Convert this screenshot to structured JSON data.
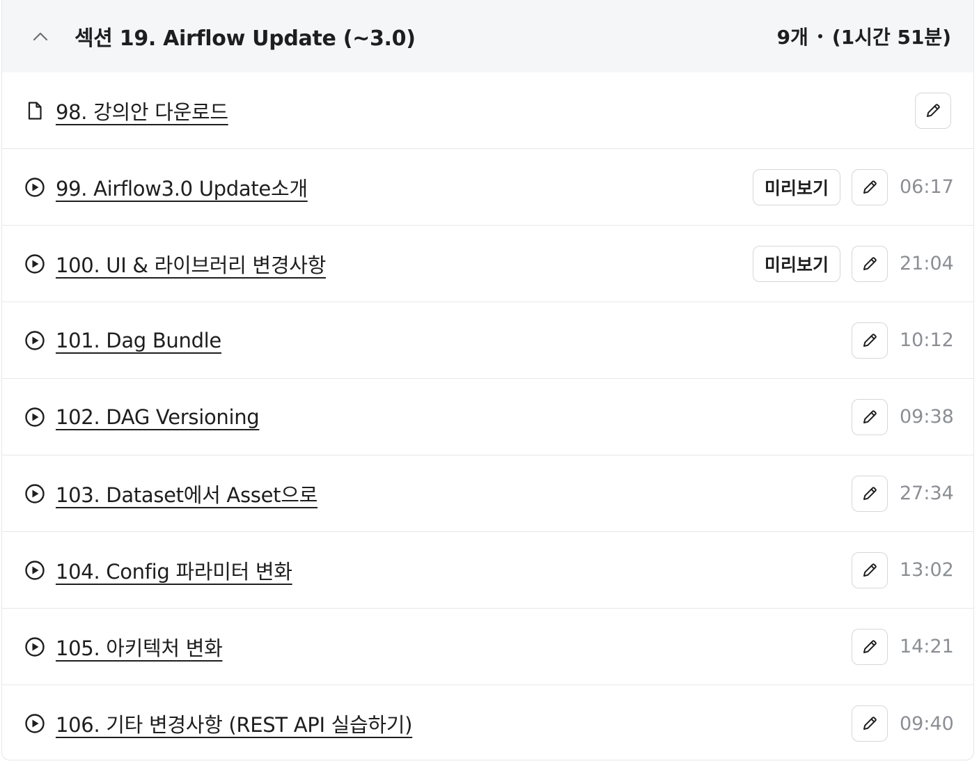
{
  "section": {
    "title": "섹션 19. Airflow Update (~3.0)",
    "count": "9개",
    "total_duration": "(1시간 51분)",
    "expanded": true
  },
  "lectures": [
    {
      "title": "98. 강의안 다운로드",
      "type": "file",
      "preview": null,
      "duration": null
    },
    {
      "title": "99. Airflow3.0 Update소개",
      "type": "video",
      "preview": "미리보기",
      "duration": "06:17"
    },
    {
      "title": "100. UI & 라이브러리 변경사항",
      "type": "video",
      "preview": "미리보기",
      "duration": "21:04"
    },
    {
      "title": "101. Dag Bundle",
      "type": "video",
      "preview": null,
      "duration": "10:12"
    },
    {
      "title": "102. DAG Versioning",
      "type": "video",
      "preview": null,
      "duration": "09:38"
    },
    {
      "title": "103. Dataset에서 Asset으로",
      "type": "video",
      "preview": null,
      "duration": "27:34"
    },
    {
      "title": "104. Config 파라미터 변화",
      "type": "video",
      "preview": null,
      "duration": "13:02"
    },
    {
      "title": "105. 아키텍처 변화",
      "type": "video",
      "preview": null,
      "duration": "14:21"
    },
    {
      "title": "106. 기타 변경사항 (REST API 실습하기)",
      "type": "video",
      "preview": null,
      "duration": "09:40"
    }
  ],
  "icons": {
    "collapse": "chevron-up-icon",
    "file": "file-icon",
    "video": "play-circle-icon",
    "edit": "pencil-icon"
  },
  "colors": {
    "header_bg": "#f5f6f8",
    "text": "#1e1e1e",
    "duration": "#8b8e93",
    "border": "#d4d6da"
  }
}
